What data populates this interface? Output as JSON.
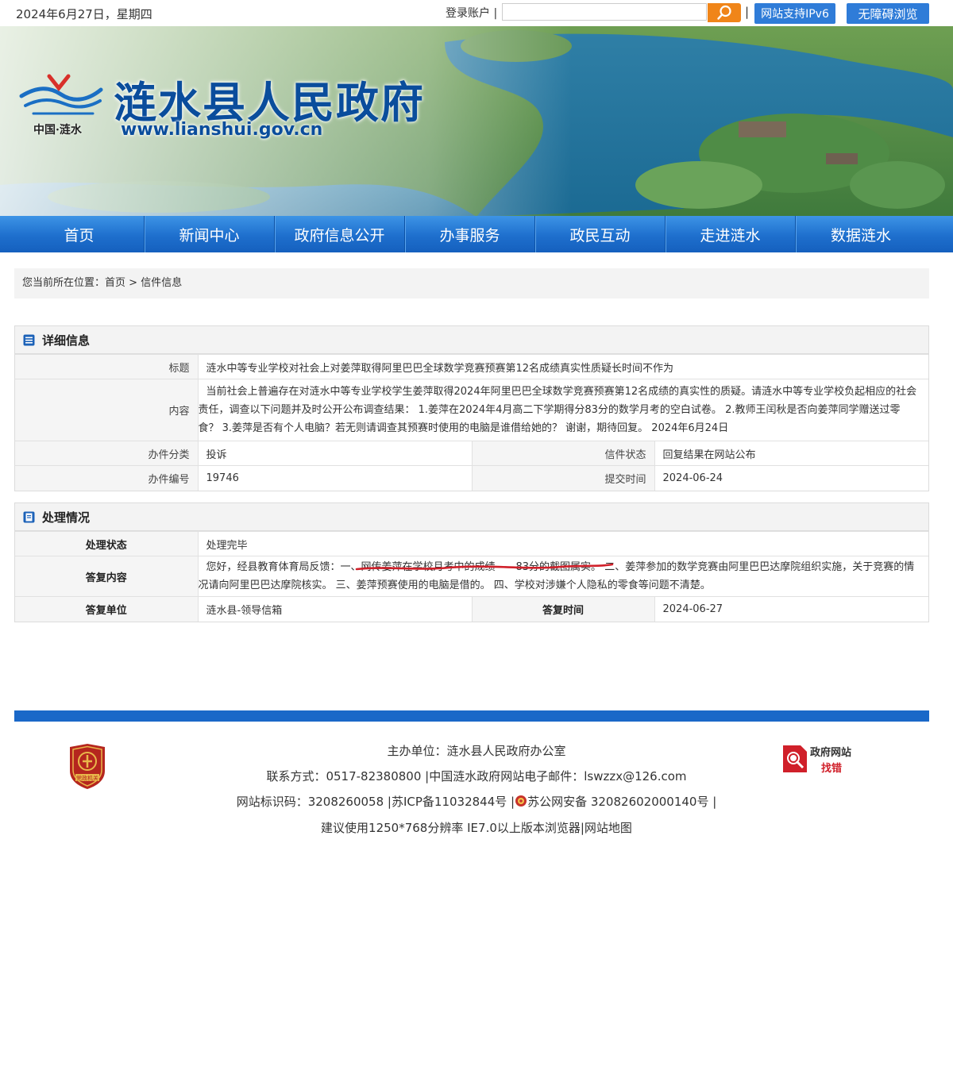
{
  "topbar": {
    "date": "2024年6月27日，星期四",
    "login": "登录账户 |",
    "search_placeholder": "",
    "separator": "|",
    "ipv6": "网站支持IPv6",
    "accessible": "无障碍浏览"
  },
  "banner": {
    "title": "涟水县人民政府",
    "url": "www.lianshui.gov.cn",
    "subtitle": "中国·涟水"
  },
  "nav": {
    "items": [
      "首页",
      "新闻中心",
      "政府信息公开",
      "办事服务",
      "政民互动",
      "走进涟水",
      "数据涟水"
    ]
  },
  "breadcrumb": {
    "prefix": "您当前所在位置：",
    "home": "首页",
    "sep": " > ",
    "current": "信件信息"
  },
  "detail": {
    "heading": "详细信息",
    "title_label": "标题",
    "title_value": "涟水中等专业学校对社会上对姜萍取得阿里巴巴全球数学竞赛预赛第12名成绩真实性质疑长时间不作为",
    "content_label": "内容",
    "content_value": "当前社会上普遍存在对涟水中等专业学校学生姜萍取得2024年阿里巴巴全球数学竞赛预赛第12名成绩的真实性的质疑。请涟水中等专业学校负起相应的社会责任，调查以下问题并及时公开公布调查结果： 1.姜萍在2024年4月高二下学期得分83分的数学月考的空白试卷。 2.教师王闰秋是否向姜萍同学赠送过零食？ 3.姜萍是否有个人电脑？若无则请调查其预赛时使用的电脑是谁借给她的？ 谢谢，期待回复。 2024年6月24日",
    "category_label": "办件分类",
    "category_value": "投诉",
    "status_label": "信件状态",
    "status_value": "回复结果在网站公布",
    "number_label": "办件编号",
    "number_value": "19746",
    "submit_label": "提交时间",
    "submit_value": "2024-06-24"
  },
  "process": {
    "heading": "处理情况",
    "state_label": "处理状态",
    "state_value": "处理完毕",
    "reply_label": "答复内容",
    "reply_pre": "您好，经县教育体育局反馈：一、",
    "reply_highlight": "网传姜萍在学校月考中的成绩——83分的截图属实。",
    "reply_post": " 二、姜萍参加的数学竞赛由阿里巴巴达摩院组织实施，关于竞赛的情况请向阿里巴巴达摩院核实。 三、姜萍预赛使用的电脑是借的。 四、学校对涉嫌个人隐私的零食等问题不清楚。",
    "unit_label": "答复单位",
    "unit_value": "涟水县-领导信箱",
    "time_label": "答复时间",
    "time_value": "2024-06-27"
  },
  "footer": {
    "host": "主办单位：涟水县人民政府办公室",
    "contact": "联系方式：0517-82380800 |中国涟水政府网站电子邮件：lswzzx@126.com",
    "ids_pre": "网站标识码：3208260058 |苏ICP备11032844号 |",
    "ids_post": "苏公网安备 32082602000140号 |",
    "advice": "建议使用1250*768分辨率 IE7.0以上版本浏览器|网站地图",
    "party_badge": "党政机关",
    "err_title": "政府网站",
    "err_sub": "找错"
  },
  "colors": {
    "nav_blue": "#1e6fcd",
    "button_blue": "#2f7cd8",
    "search_orange": "#f08519",
    "underline_red": "#d0202a"
  }
}
